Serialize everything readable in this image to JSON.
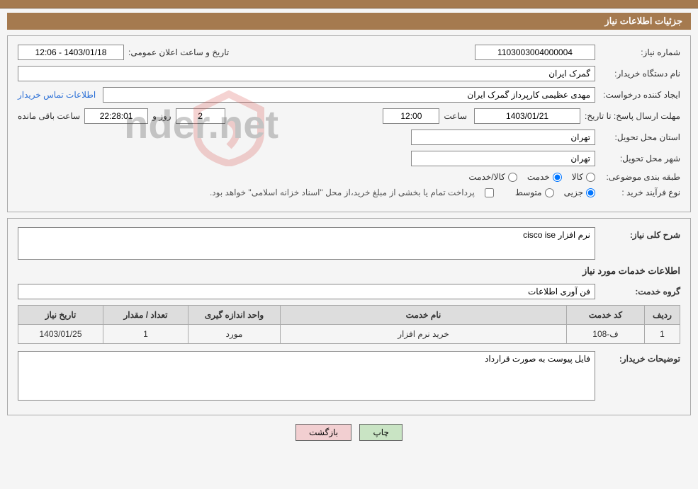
{
  "title": "جزئیات اطلاعات نیاز",
  "fields": {
    "need_no_label": "شماره نیاز:",
    "need_no": "1103003004000004",
    "announce_label": "تاریخ و ساعت اعلان عمومی:",
    "announce_value": "1403/01/18 - 12:06",
    "buyer_org_label": "نام دستگاه خریدار:",
    "buyer_org": "گمرک ایران",
    "requester_label": "ایجاد کننده درخواست:",
    "requester": "مهدی عظیمی کارپرداز گمرک ایران",
    "contact_link": "اطلاعات تماس خریدار",
    "deadline_label": "مهلت ارسال پاسخ: تا تاریخ:",
    "deadline_date": "1403/01/21",
    "time_label": "ساعت",
    "deadline_time": "12:00",
    "days": "2",
    "days_and": "روز و",
    "countdown": "22:28:01",
    "remain_label": "ساعت باقی مانده",
    "province_label": "استان محل تحویل:",
    "province": "تهران",
    "city_label": "شهر محل تحویل:",
    "city": "تهران",
    "subject_cat_label": "طبقه بندی موضوعی:",
    "radio_goods": "کالا",
    "radio_service": "خدمت",
    "radio_goods_service": "کالا/خدمت",
    "purchase_type_label": "نوع فرآیند خرید :",
    "radio_minor": "جزیی",
    "radio_medium": "متوسط",
    "payment_note": "پرداخت تمام یا بخشی از مبلغ خرید،از محل \"اسناد خزانه اسلامی\" خواهد بود.",
    "summary_label": "شرح کلی نیاز:",
    "summary": "نرم افزار cisco ise",
    "service_info_heading": "اطلاعات خدمات مورد نیاز",
    "group_label": "گروه خدمت:",
    "group": "فن آوری اطلاعات",
    "buyer_notes_label": "توضیحات خریدار:",
    "buyer_notes": "فایل پیوست به صورت قرارداد"
  },
  "table": {
    "headers": [
      "ردیف",
      "کد خدمت",
      "نام خدمت",
      "واحد اندازه گیری",
      "تعداد / مقدار",
      "تاریخ نیاز"
    ],
    "rows": [
      {
        "idx": "1",
        "code": "ف-108",
        "name": "خرید نرم افزار",
        "unit": "مورد",
        "qty": "1",
        "date": "1403/01/25"
      }
    ]
  },
  "buttons": {
    "print": "چاپ",
    "back": "بازگشت"
  },
  "watermark": "AriaTender.net"
}
